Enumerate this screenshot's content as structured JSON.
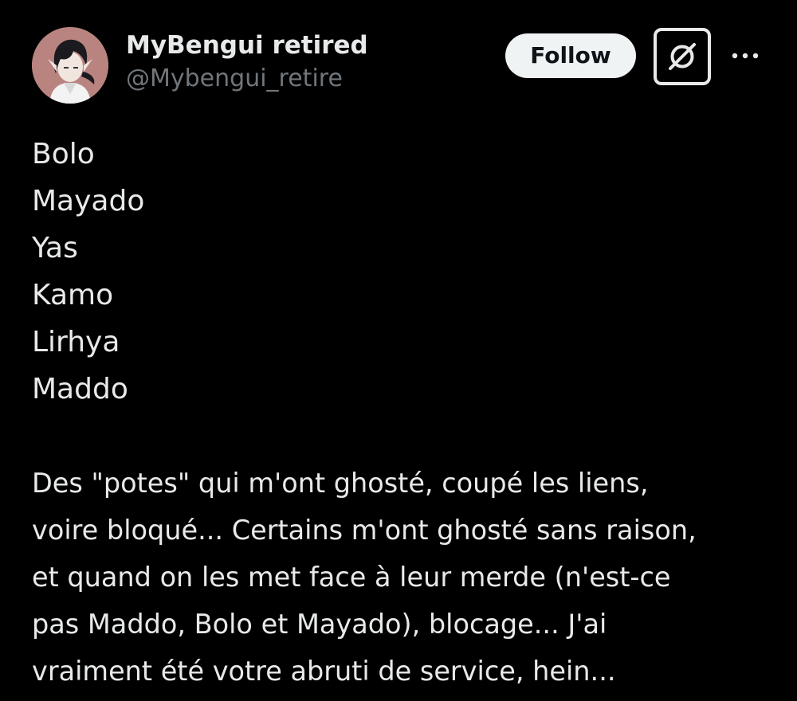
{
  "author": {
    "display_name": "MyBengui retired",
    "handle": "@Mybengui_retire"
  },
  "actions": {
    "follow_label": "Follow",
    "grok_icon": "grok-icon",
    "more_icon": "more-horizontal-icon"
  },
  "post": {
    "names": [
      "Bolo",
      "Mayado",
      "Yas",
      "Kamo",
      "Lirhya",
      "Maddo"
    ],
    "paragraph_lines": [
      "Des \"potes\" qui m'ont ghosté, coupé les liens,",
      "voire bloqué... Certains m'ont ghosté sans raison,",
      "et quand on les met face à leur merde (n'est-ce",
      "pas Maddo, Bolo et Mayado), blocage... J'ai",
      "vraiment été votre abruti de service, hein..."
    ]
  },
  "colors": {
    "background": "#000000",
    "text_primary": "#e7e9ea",
    "text_secondary": "#71767b",
    "follow_bg": "#eff3f4"
  }
}
